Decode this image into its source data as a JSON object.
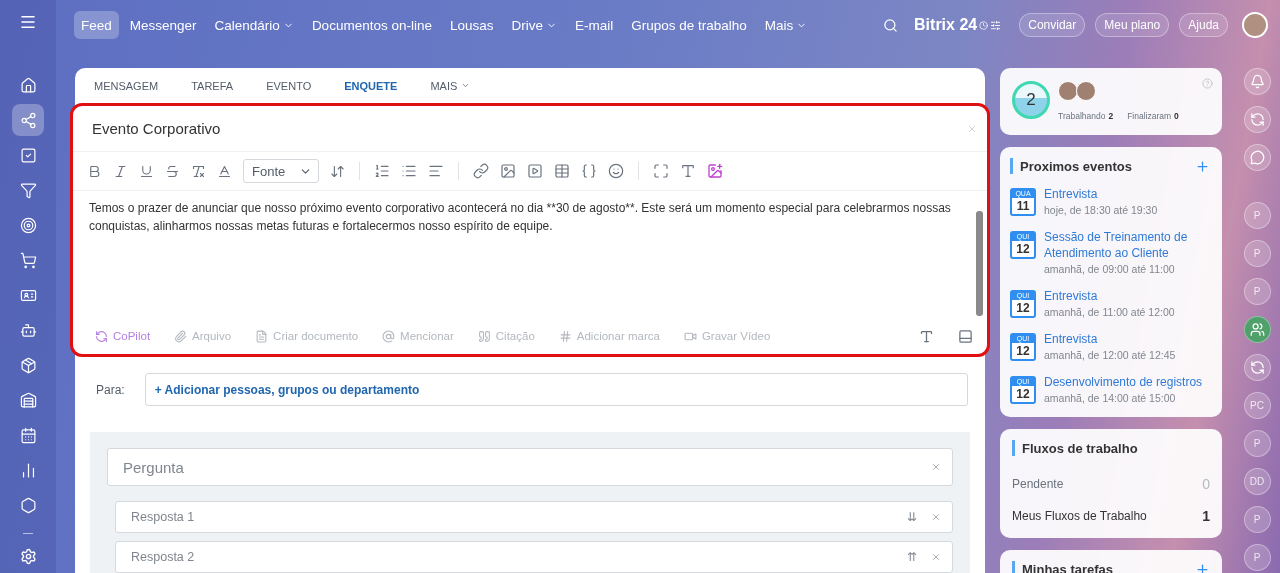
{
  "top_nav": {
    "items": [
      {
        "label": "Feed",
        "selected": true,
        "dropdown": false
      },
      {
        "label": "Messenger",
        "selected": false,
        "dropdown": false
      },
      {
        "label": "Calendário",
        "selected": false,
        "dropdown": true
      },
      {
        "label": "Documentos on-line",
        "selected": false,
        "dropdown": false
      },
      {
        "label": "Lousas",
        "selected": false,
        "dropdown": false
      },
      {
        "label": "Drive",
        "selected": false,
        "dropdown": true
      },
      {
        "label": "E-mail",
        "selected": false,
        "dropdown": false
      },
      {
        "label": "Grupos de trabalho",
        "selected": false,
        "dropdown": false
      },
      {
        "label": "Mais",
        "selected": false,
        "dropdown": true
      }
    ],
    "logo": {
      "name": "Bitrix",
      "number": "24"
    },
    "buttons": [
      "Convidar",
      "Meu plano",
      "Ajuda"
    ]
  },
  "sidebar": {
    "items": [
      {
        "selected": false
      },
      {
        "selected": true
      },
      {
        "selected": false
      },
      {
        "selected": false
      },
      {
        "selected": false
      },
      {
        "selected": false
      },
      {
        "selected": false
      },
      {
        "selected": false
      },
      {
        "selected": false
      },
      {
        "selected": false
      },
      {
        "selected": false
      },
      {
        "selected": false
      },
      {
        "selected": false
      }
    ]
  },
  "composer": {
    "tabs": [
      {
        "label": "MENSAGEM",
        "selected": false,
        "dropdown": false
      },
      {
        "label": "TAREFA",
        "selected": false,
        "dropdown": false
      },
      {
        "label": "EVENTO",
        "selected": false,
        "dropdown": false
      },
      {
        "label": "ENQUETE",
        "selected": true,
        "dropdown": false
      },
      {
        "label": "MAIS",
        "selected": false,
        "dropdown": true
      }
    ],
    "title": "Evento Corporativo",
    "font": "Fonte",
    "body": "Temos o prazer de anunciar que nosso próximo evento corporativo acontecerá no dia **30 de agosto**. Este será um momento especial para celebrarmos nossas conquistas, alinharmos nossas metas futuras e fortalecermos nosso espírito de equipe.",
    "actions": [
      {
        "kind": "ai",
        "label": "CoPilot"
      },
      {
        "kind": "plain",
        "label": "Arquivo"
      },
      {
        "kind": "plain",
        "label": "Criar documento"
      },
      {
        "kind": "plain",
        "label": "Mencionar"
      },
      {
        "kind": "plain",
        "label": "Citação"
      },
      {
        "kind": "plain",
        "label": "Adicionar marca"
      },
      {
        "kind": "plain",
        "label": "Gravar Vídeo"
      }
    ],
    "recipients": {
      "label": "Para:",
      "link": "+ Adicionar pessoas, grupos ou departamento"
    },
    "poll": {
      "question": {
        "placeholder": "Pergunta"
      },
      "answers": [
        {
          "placeholder": "Resposta 1",
          "move": "⇊"
        },
        {
          "placeholder": "Resposta 2",
          "move": "⇈"
        }
      ]
    }
  },
  "timeman": {
    "count": "2",
    "stats": [
      {
        "label": "Trabalhando",
        "value": "2"
      },
      {
        "label": "Finalizaram",
        "value": "0"
      }
    ]
  },
  "events": {
    "title": "Proximos eventos",
    "items": [
      {
        "weekday": "QUA",
        "day": "11",
        "title": "Entrevista",
        "time": "hoje, de 18:30 até 19:30"
      },
      {
        "weekday": "QUI",
        "day": "12",
        "title": "Sessão de Treinamento de Atendimento ao Cliente",
        "time": "amanhã, de 09:00 até 11:00"
      },
      {
        "weekday": "QUI",
        "day": "12",
        "title": "Entrevista",
        "time": "amanhã, de 11:00 até 12:00"
      },
      {
        "weekday": "QUI",
        "day": "12",
        "title": "Entrevista",
        "time": "amanhã, de 12:00 até 12:45"
      },
      {
        "weekday": "QUI",
        "day": "12",
        "title": "Desenvolvimento de registros",
        "time": "amanhã, de 14:00 até 15:00"
      }
    ]
  },
  "workflows": {
    "title": "Fluxos de trabalho",
    "rows": [
      {
        "label": "Pendente",
        "count": "0",
        "active": false
      },
      {
        "label": "Meus Fluxos de Trabalho",
        "count": "1",
        "active": true
      }
    ]
  },
  "tasks": {
    "title": "Minhas tarefas"
  },
  "rail": [
    {
      "kind": "bell"
    },
    {
      "kind": "copilot"
    },
    {
      "kind": "chat"
    },
    {
      "kind": "initials",
      "text": "P"
    },
    {
      "kind": "initials",
      "text": "P"
    },
    {
      "kind": "initials",
      "text": "P"
    },
    {
      "kind": "group"
    },
    {
      "kind": "copilot"
    },
    {
      "kind": "initials",
      "text": "PC"
    },
    {
      "kind": "initials",
      "text": "P"
    },
    {
      "kind": "initials",
      "text": "DD"
    },
    {
      "kind": "initials",
      "text": "P"
    },
    {
      "kind": "initials",
      "text": "P"
    }
  ]
}
